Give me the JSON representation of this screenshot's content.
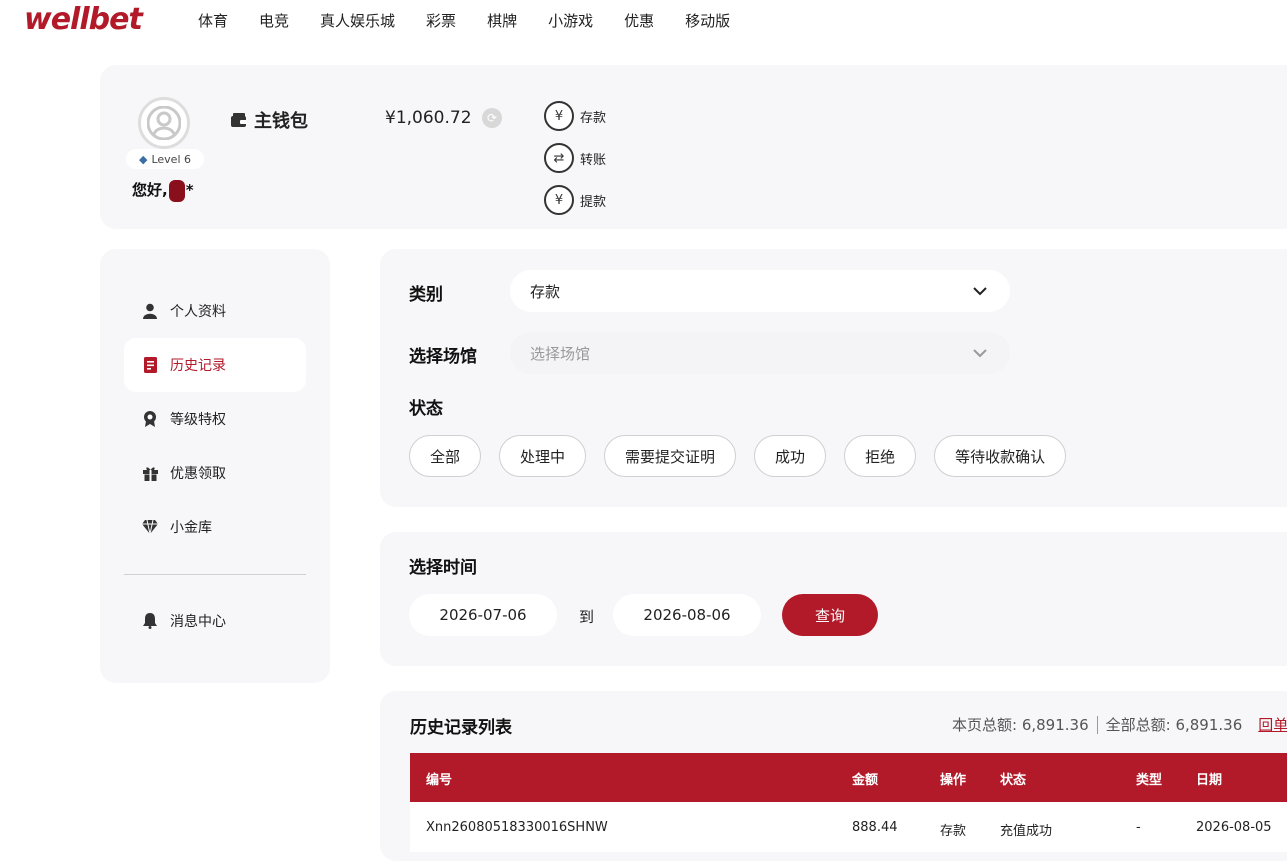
{
  "brand": {
    "logo_text": "wellbet",
    "accent": "#b21a2a"
  },
  "nav": [
    "体育",
    "电竞",
    "真人娱乐城",
    "彩票",
    "棋牌",
    "小游戏",
    "优惠",
    "移动版"
  ],
  "profile": {
    "level": "Level 6",
    "greeting_prefix": "您好,",
    "greeting_suffix": "*",
    "wallet_title": "主钱包",
    "balance": "¥1,060.72",
    "actions": [
      {
        "label": "存款",
        "icon": "deposit-icon"
      },
      {
        "label": "转账",
        "icon": "transfer-icon"
      },
      {
        "label": "提款",
        "icon": "withdraw-icon"
      }
    ]
  },
  "sidebar": {
    "items": [
      {
        "label": "个人资料",
        "icon": "user-icon"
      },
      {
        "label": "历史记录",
        "icon": "history-icon",
        "active": true
      },
      {
        "label": "等级特权",
        "icon": "badge-icon"
      },
      {
        "label": "优惠领取",
        "icon": "gift-icon"
      },
      {
        "label": "小金库",
        "icon": "diamond-icon"
      }
    ],
    "bottom_item": {
      "label": "消息中心",
      "icon": "bell-icon"
    }
  },
  "filter": {
    "category_label": "类别",
    "category_value": "存款",
    "venue_label": "选择场馆",
    "venue_placeholder": "选择场馆",
    "status_label": "状态",
    "status_options": [
      "全部",
      "处理中",
      "需要提交证明",
      "成功",
      "拒绝",
      "等待收款确认"
    ]
  },
  "time": {
    "label": "选择时间",
    "start": "2026-07-06",
    "to": "到",
    "end": "2026-08-06",
    "query_label": "查询"
  },
  "list": {
    "title": "历史记录列表",
    "page_total": "本页总额: 6,891.36",
    "all_total": "全部总额: 6,891.36",
    "link": "回单",
    "columns": [
      "编号",
      "金额",
      "操作",
      "状态",
      "类型",
      "日期"
    ],
    "rows": [
      [
        "Xnn26080518330016SHNW",
        "888.44",
        "存款",
        "充值成功",
        "-",
        "2026-08-05"
      ]
    ]
  }
}
